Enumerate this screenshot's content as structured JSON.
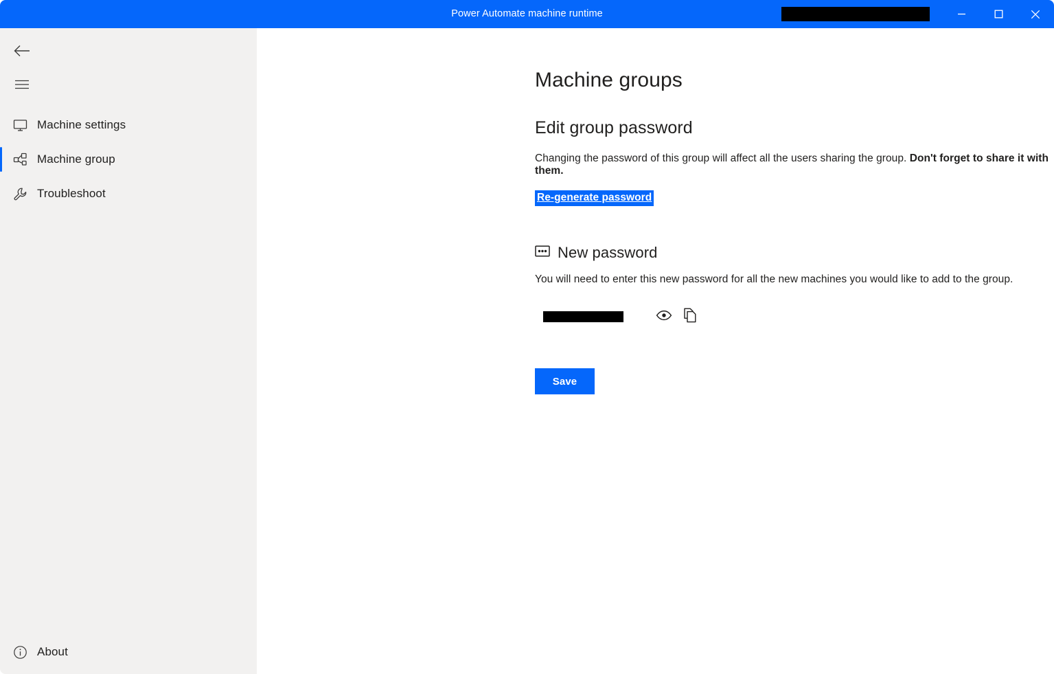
{
  "window": {
    "title": "Power Automate machine runtime",
    "title_redacted": true,
    "controls": {
      "minimize": "minimize-button",
      "maximize": "maximize-button",
      "close": "close-button"
    },
    "accent_color": "#0567fb",
    "sidebar_color": "#f2f1f0",
    "content_color": "#ffffff"
  },
  "sidebar": {
    "back_icon": "back-arrow-icon",
    "menu_icon": "hamburger-menu-icon",
    "items": [
      {
        "label": "Machine settings",
        "icon": "monitor-icon",
        "selected": false
      },
      {
        "label": "Machine group",
        "icon": "machine-group-icon",
        "selected": true
      },
      {
        "label": "Troubleshoot",
        "icon": "wrench-icon",
        "selected": false
      }
    ],
    "footer": {
      "label": "About",
      "icon": "info-circle-icon"
    }
  },
  "main": {
    "page_title": "Machine groups",
    "section_title": "Edit group password",
    "description_normal": "Changing the password of this group will affect all the users sharing the group. ",
    "description_bold": "Don't forget to share it with them.",
    "regenerate_link": "Re-generate password",
    "regenerate_link_selected": true,
    "new_password": {
      "icon": "password-dots-icon",
      "heading": "New password",
      "description": "You will need to enter this new password for all the new machines you would like to add to the group.",
      "value_redacted": true,
      "reveal_icon": "eye-icon",
      "copy_icon": "copy-icon"
    },
    "save_label": "Save"
  }
}
